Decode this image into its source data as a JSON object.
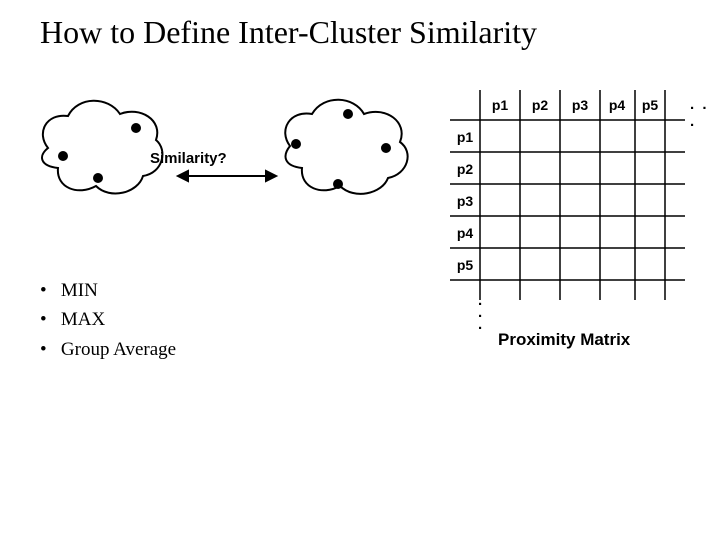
{
  "title": "How to Define Inter-Cluster Similarity",
  "similarity_label": "Similarity?",
  "bullets": {
    "items": [
      "MIN",
      "MAX",
      "Group Average"
    ]
  },
  "matrix": {
    "col_headers": [
      "p1",
      "p2",
      "p3",
      "p4",
      "p5"
    ],
    "row_headers": [
      "p1",
      "p2",
      "p3",
      "p4",
      "p5"
    ],
    "caption": "Proximity Matrix",
    "col_ellipsis": ". . .",
    "row_ellipsis": "."
  }
}
